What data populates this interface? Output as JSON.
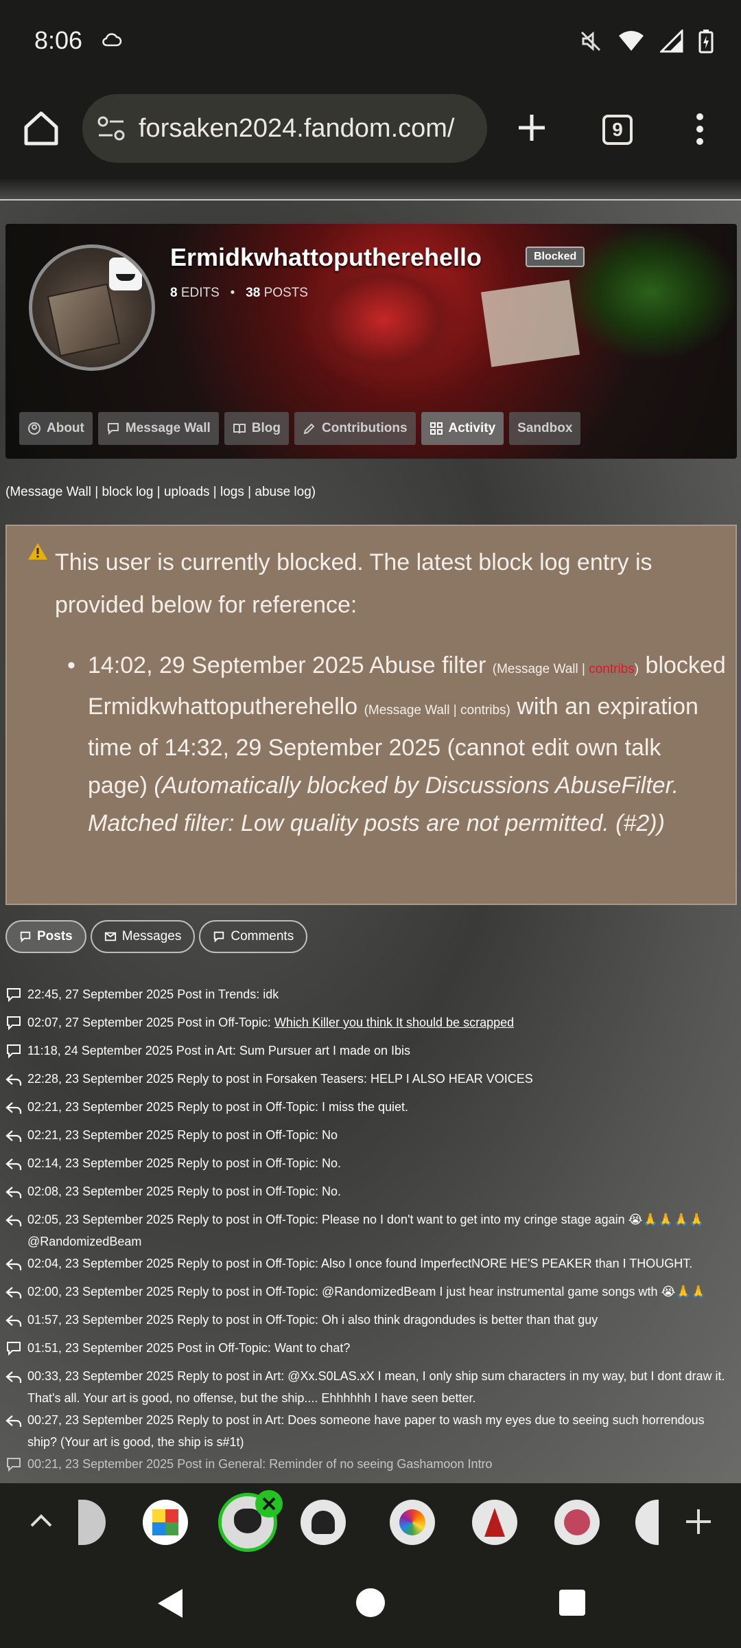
{
  "status_bar": {
    "time": "8:06"
  },
  "browser": {
    "url": "forsaken2024.fandom.com/",
    "tab_count": "9"
  },
  "profile": {
    "username": "Ermidkwhattoputherehello",
    "badge": "Blocked",
    "edits_count": "8",
    "edits_label": "EDITS",
    "posts_count": "38",
    "posts_label": "POSTS",
    "tabs": [
      {
        "label": "About",
        "icon": "user-icon"
      },
      {
        "label": "Message Wall",
        "icon": "comment-icon"
      },
      {
        "label": "Blog",
        "icon": "book-icon"
      },
      {
        "label": "Contributions",
        "icon": "pencil-icon"
      },
      {
        "label": "Activity",
        "icon": "grid-icon"
      },
      {
        "label": "Sandbox",
        "icon": ""
      }
    ]
  },
  "tool_links": {
    "message_wall": "Message Wall",
    "block_log": "block log",
    "uploads": "uploads",
    "logs": "logs",
    "abuse_log": "abuse log"
  },
  "block_notice": {
    "lead": "This user is currently blocked. The latest block log entry is provided below for reference:",
    "timestamp": "14:02, 29 September 2025",
    "actor": "Abuse filter",
    "actor_wall": "Message Wall",
    "actor_contribs": "contribs",
    "verb": "blocked",
    "target": "Ermidkwhattoputherehello",
    "target_wall": "Message Wall",
    "target_contribs": "contribs",
    "expiry": "with an expiration time of 14:32, 29 September 2025 (cannot edit own talk page)",
    "reason": "(Automatically blocked by Discussions AbuseFilter. Matched filter: Low quality posts are not permitted. (#2))"
  },
  "filters": [
    {
      "label": "Posts",
      "active": true
    },
    {
      "label": "Messages",
      "active": false
    },
    {
      "label": "Comments",
      "active": false
    }
  ],
  "activity": [
    {
      "kind": "post",
      "time": "22:45, 27 September 2025",
      "action": "Post in Trends:",
      "title": "idk",
      "underline": false
    },
    {
      "kind": "post",
      "time": "02:07, 27 September 2025",
      "action": "Post in Off-Topic:",
      "title": "Which Killer you think It should be scrapped",
      "underline": true
    },
    {
      "kind": "post",
      "time": "11:18, 24 September 2025",
      "action": "Post in Art:",
      "title": "Sum Pursuer art I made on Ibis",
      "underline": false
    },
    {
      "kind": "reply",
      "time": "22:28, 23 September 2025",
      "action": "Reply to post in Forsaken Teasers:",
      "title": "HELP I ALSO HEAR VOICES",
      "underline": false
    },
    {
      "kind": "reply",
      "time": "02:21, 23 September 2025",
      "action": "Reply to post in Off-Topic:",
      "title": "I miss the quiet.",
      "underline": false
    },
    {
      "kind": "reply",
      "time": "02:21, 23 September 2025",
      "action": "Reply to post in Off-Topic:",
      "title": "No",
      "underline": false
    },
    {
      "kind": "reply",
      "time": "02:14, 23 September 2025",
      "action": "Reply to post in Off-Topic:",
      "title": "No.",
      "underline": false
    },
    {
      "kind": "reply",
      "time": "02:08, 23 September 2025",
      "action": "Reply to post in Off-Topic:",
      "title": "No.",
      "underline": false
    },
    {
      "kind": "reply",
      "time": "02:05, 23 September 2025",
      "action": "Reply to post in Off-Topic:",
      "title": "Please no I don't want to get into my cringe stage again 😭🙏🙏🙏🙏 @RandomizedBeam",
      "underline": false
    },
    {
      "kind": "reply",
      "time": "02:04, 23 September 2025",
      "action": "Reply to post in Off-Topic:",
      "title": "Also I once found ImperfectNORE HE'S PEAKER than I THOUGHT.",
      "underline": false
    },
    {
      "kind": "reply",
      "time": "02:00, 23 September 2025",
      "action": "Reply to post in Off-Topic:",
      "title": "@RandomizedBeam I just hear instrumental game songs wth 😭🙏🙏",
      "underline": false
    },
    {
      "kind": "reply",
      "time": "01:57, 23 September 2025",
      "action": "Reply to post in Off-Topic:",
      "title": "Oh i also think dragondudes is better than that guy",
      "underline": false
    },
    {
      "kind": "post",
      "time": "01:51, 23 September 2025",
      "action": "Post in Off-Topic:",
      "title": "Want to chat?",
      "underline": false
    },
    {
      "kind": "reply",
      "time": "00:33, 23 September 2025",
      "action": "Reply to post in Art:",
      "title": "@Xx.S0LAS.xX I mean, I only ship sum characters in my way, but I dont draw it. That's all. Your art is good, no offense, but the ship.... Ehhhhhh I have seen better.",
      "underline": false
    },
    {
      "kind": "reply",
      "time": "00:27, 23 September 2025",
      "action": "Reply to post in Art:",
      "title": "Does someone have paper to wash my eyes due to seeing such horrendous ship? (Your art is good, the ship is s#1t)",
      "underline": false
    },
    {
      "kind": "post",
      "time": "00:21, 23 September 2025",
      "action": "Post in General:",
      "title": "Reminder of no seeing Gashamoon Intro",
      "underline": false
    }
  ]
}
